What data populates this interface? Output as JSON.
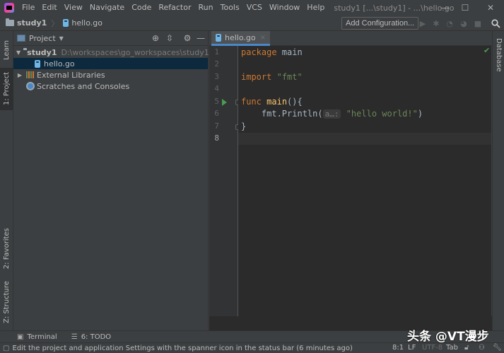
{
  "titlebar": {
    "menu": [
      "File",
      "Edit",
      "View",
      "Navigate",
      "Code",
      "Refactor",
      "Run",
      "Tools",
      "VCS",
      "Window",
      "Help"
    ],
    "window_title": "study1 [...\\study1] - ...\\hello.go",
    "controls": {
      "minimize": "—",
      "maximize": "☐",
      "close": "✕"
    }
  },
  "navbar": {
    "breadcrumbs": [
      "study1",
      "hello.go"
    ],
    "separator": "〉",
    "add_configuration": "Add Configuration...",
    "toolbar_icons": [
      "run-icon",
      "debug-icon",
      "coverage-icon",
      "profile-icon",
      "stop-icon",
      "search-icon"
    ]
  },
  "left_strip": {
    "tabs": [
      {
        "label": "Learn",
        "icon": "learn-icon"
      },
      {
        "label": "1: Project",
        "icon": "project-icon"
      },
      {
        "label": "2: Favorites",
        "icon": "star-icon"
      },
      {
        "label": "Z: Structure",
        "icon": "structure-icon"
      }
    ]
  },
  "project_panel": {
    "view_label": "Project",
    "header_icons": [
      "locate-icon",
      "collapse-all-icon",
      "gear-icon",
      "hide-icon"
    ],
    "tree": [
      {
        "label": "study1",
        "path": "D:\\workspaces\\go_workspaces\\study1",
        "expanded": true,
        "type": "folder"
      },
      {
        "label": "hello.go",
        "type": "go-file",
        "selected": true
      },
      {
        "label": "External Libraries",
        "type": "libraries",
        "expanded": false
      },
      {
        "label": "Scratches and Consoles",
        "type": "scratches"
      }
    ]
  },
  "editor": {
    "tab": {
      "label": "hello.go",
      "close": "×"
    },
    "line_numbers": [
      "1",
      "2",
      "3",
      "4",
      "5",
      "6",
      "7",
      "8"
    ],
    "lines": [
      {
        "parts": [
          [
            "kw",
            "package"
          ],
          [
            "plain",
            " main"
          ]
        ]
      },
      {
        "parts": []
      },
      {
        "parts": [
          [
            "kw",
            "import"
          ],
          [
            "plain",
            " "
          ],
          [
            "str",
            "\"fmt\""
          ]
        ]
      },
      {
        "parts": []
      },
      {
        "parts": [
          [
            "kw",
            "func"
          ],
          [
            "plain",
            " "
          ],
          [
            "fn",
            "main"
          ],
          [
            "plain",
            "(){"
          ]
        ]
      },
      {
        "parts": [
          [
            "plain",
            "    fmt.Println("
          ],
          [
            "hint",
            "a…:"
          ],
          [
            "plain",
            " "
          ],
          [
            "str",
            "\"hello world!\""
          ],
          [
            "plain",
            ")"
          ]
        ]
      },
      {
        "parts": [
          [
            "plain",
            "}"
          ]
        ]
      },
      {
        "parts": []
      }
    ],
    "current_line": 8,
    "inspection_status": "✔"
  },
  "right_strip": {
    "tabs": [
      {
        "label": "Database",
        "icon": "database-icon"
      }
    ]
  },
  "bottom_tabs": [
    {
      "label": "Terminal",
      "icon": "terminal-icon"
    },
    {
      "label": "6: TODO",
      "icon": "todo-icon"
    }
  ],
  "statusbar": {
    "message": "Edit the project and application Settings with the spanner icon in the status bar (6 minutes ago)",
    "position": "8:1",
    "line_separator": "LF",
    "encoding": "UTF-8",
    "indent": "Tab"
  },
  "watermark": "头条 @VT漫步"
}
